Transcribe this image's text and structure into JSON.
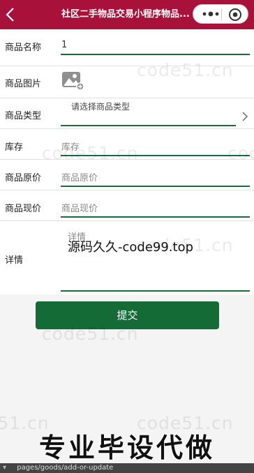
{
  "header": {
    "title": "社区二手物品交易小程序物品...",
    "background": "#a8123a"
  },
  "form": {
    "name": {
      "label": "商品名称",
      "value": "1"
    },
    "image": {
      "label": "商品图片"
    },
    "type": {
      "label": "商品类型",
      "placeholder": "请选择商品类型"
    },
    "stock": {
      "label": "库存",
      "placeholder": "库存"
    },
    "original_price": {
      "label": "商品原价",
      "placeholder": "商品原价"
    },
    "current_price": {
      "label": "商品现价",
      "placeholder": "商品现价"
    },
    "detail": {
      "label": "详情",
      "placeholder": "详情"
    }
  },
  "submit_label": "提交",
  "overlay_text": "源码久久-code99.top",
  "watermark_text": "code51.cn",
  "promo_text": "专业毕设代做",
  "bottom_bar": {
    "path": "pages/goods/add-or-update"
  },
  "colors": {
    "accent": "#1f6a3a",
    "button": "#146b36"
  }
}
